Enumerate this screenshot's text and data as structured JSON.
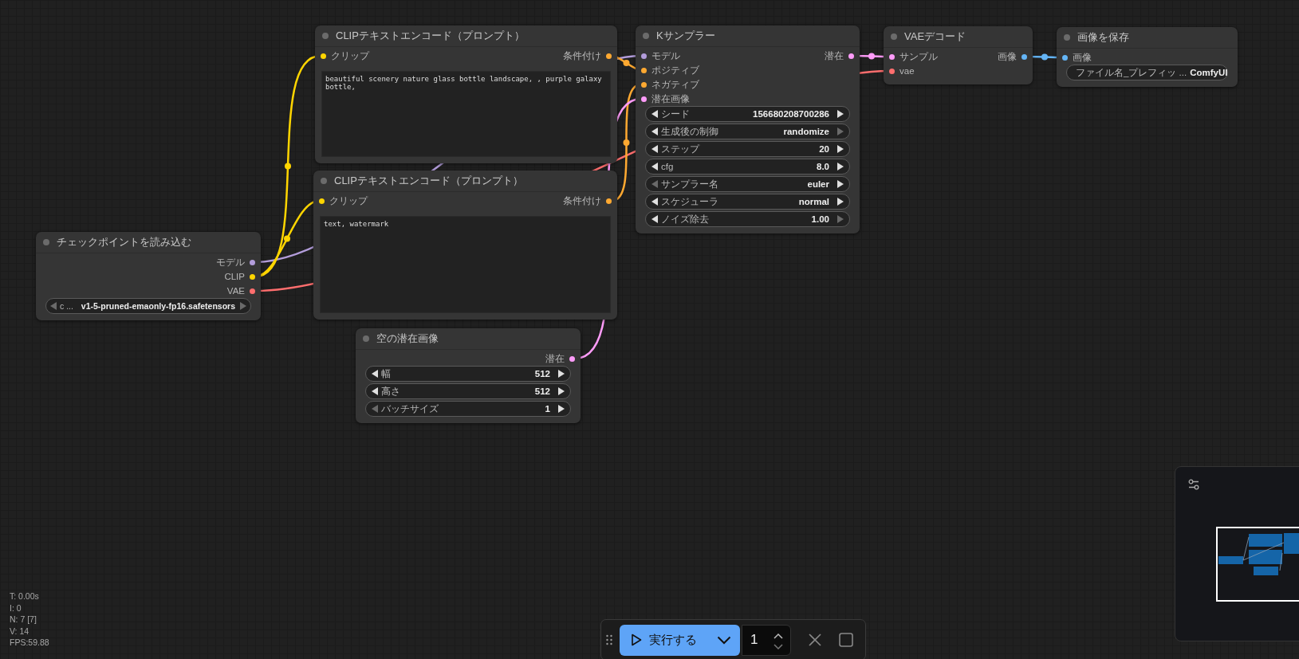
{
  "nodes": [
    {
      "title": "チェックポイントを読み込む",
      "outputs": [
        {
          "label": "モデル",
          "color": "#b39ddb"
        },
        {
          "label": "CLIP",
          "color": "#ffd500"
        },
        {
          "label": "VAE",
          "color": "#ff6e6e"
        }
      ],
      "widgets": [
        {
          "kind": "combo",
          "label": "c ...",
          "value": "v1-5-pruned-emaonly-fp16.safetensors",
          "prev_disabled": true,
          "next_disabled": true
        }
      ]
    },
    {
      "title": "CLIPテキストエンコード（プロンプト）",
      "inputs": [
        {
          "label": "クリップ",
          "color": "#ffd500"
        }
      ],
      "outputs": [
        {
          "label": "条件付け",
          "color": "#ffa931"
        }
      ],
      "prompt": "beautiful scenery nature glass bottle landscape, , purple galaxy bottle,"
    },
    {
      "title": "CLIPテキストエンコード（プロンプト）",
      "inputs": [
        {
          "label": "クリップ",
          "color": "#ffd500"
        }
      ],
      "outputs": [
        {
          "label": "条件付け",
          "color": "#ffa931"
        }
      ],
      "prompt": "text, watermark"
    },
    {
      "title": "空の潜在画像",
      "outputs": [
        {
          "label": "潜在",
          "color": "#ff9cf9"
        }
      ],
      "widgets": [
        {
          "kind": "number",
          "label": "幅",
          "value": "512",
          "prev_disabled": false,
          "next_disabled": false
        },
        {
          "kind": "number",
          "label": "高さ",
          "value": "512",
          "prev_disabled": false,
          "next_disabled": false
        },
        {
          "kind": "number",
          "label": "バッチサイズ",
          "value": "1",
          "prev_disabled": true,
          "next_disabled": false
        }
      ]
    },
    {
      "title": "Kサンプラー",
      "inputs": [
        {
          "label": "モデル",
          "color": "#b39ddb"
        },
        {
          "label": "ポジティブ",
          "color": "#ffa931"
        },
        {
          "label": "ネガティブ",
          "color": "#ffa931"
        },
        {
          "label": "潜在画像",
          "color": "#ff9cf9"
        }
      ],
      "outputs": [
        {
          "label": "潜在",
          "color": "#ff9cf9"
        }
      ],
      "widgets": [
        {
          "kind": "number",
          "label": "シード",
          "value": "156680208700286",
          "prev_disabled": false,
          "next_disabled": false
        },
        {
          "kind": "combo",
          "label": "生成後の制御",
          "value": "randomize",
          "prev_disabled": false,
          "next_disabled": true
        },
        {
          "kind": "number",
          "label": "ステップ",
          "value": "20",
          "prev_disabled": false,
          "next_disabled": false
        },
        {
          "kind": "number",
          "label": "cfg",
          "value": "8.0",
          "prev_disabled": false,
          "next_disabled": false
        },
        {
          "kind": "combo",
          "label": "サンプラー名",
          "value": "euler",
          "prev_disabled": true,
          "next_disabled": false
        },
        {
          "kind": "combo",
          "label": "スケジューラ",
          "value": "normal",
          "prev_disabled": false,
          "next_disabled": false
        },
        {
          "kind": "number",
          "label": "ノイズ除去",
          "value": "1.00",
          "prev_disabled": false,
          "next_disabled": true
        }
      ]
    },
    {
      "title": "VAEデコード",
      "inputs": [
        {
          "label": "サンプル",
          "color": "#ff9cf9"
        },
        {
          "label": "vae",
          "color": "#ff6e6e"
        }
      ],
      "outputs": [
        {
          "label": "画像",
          "color": "#64b5f6"
        }
      ]
    },
    {
      "title": "画像を保存",
      "inputs": [
        {
          "label": "画像",
          "color": "#64b5f6"
        }
      ],
      "widgets": [
        {
          "kind": "text",
          "label": "ファイル名_プレフィッ ...",
          "value": "ComfyUI"
        }
      ]
    }
  ],
  "stats": [
    "T: 0.00s",
    "I: 0",
    "N: 7 [7]",
    "V: 14",
    "FPS:59.88"
  ],
  "queue_bar": {
    "run_label": "実行する",
    "batch_count": "1"
  }
}
